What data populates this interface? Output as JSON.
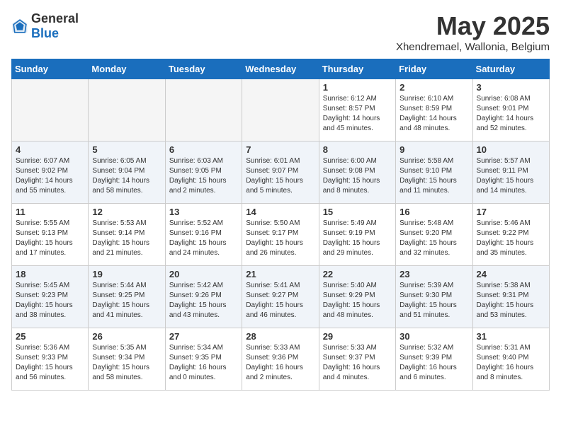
{
  "logo": {
    "text_general": "General",
    "text_blue": "Blue"
  },
  "header": {
    "title": "May 2025",
    "subtitle": "Xhendremael, Wallonia, Belgium"
  },
  "days_of_week": [
    "Sunday",
    "Monday",
    "Tuesday",
    "Wednesday",
    "Thursday",
    "Friday",
    "Saturday"
  ],
  "weeks": [
    [
      {
        "day": "",
        "info": ""
      },
      {
        "day": "",
        "info": ""
      },
      {
        "day": "",
        "info": ""
      },
      {
        "day": "",
        "info": ""
      },
      {
        "day": "1",
        "info": "Sunrise: 6:12 AM\nSunset: 8:57 PM\nDaylight: 14 hours\nand 45 minutes."
      },
      {
        "day": "2",
        "info": "Sunrise: 6:10 AM\nSunset: 8:59 PM\nDaylight: 14 hours\nand 48 minutes."
      },
      {
        "day": "3",
        "info": "Sunrise: 6:08 AM\nSunset: 9:01 PM\nDaylight: 14 hours\nand 52 minutes."
      }
    ],
    [
      {
        "day": "4",
        "info": "Sunrise: 6:07 AM\nSunset: 9:02 PM\nDaylight: 14 hours\nand 55 minutes."
      },
      {
        "day": "5",
        "info": "Sunrise: 6:05 AM\nSunset: 9:04 PM\nDaylight: 14 hours\nand 58 minutes."
      },
      {
        "day": "6",
        "info": "Sunrise: 6:03 AM\nSunset: 9:05 PM\nDaylight: 15 hours\nand 2 minutes."
      },
      {
        "day": "7",
        "info": "Sunrise: 6:01 AM\nSunset: 9:07 PM\nDaylight: 15 hours\nand 5 minutes."
      },
      {
        "day": "8",
        "info": "Sunrise: 6:00 AM\nSunset: 9:08 PM\nDaylight: 15 hours\nand 8 minutes."
      },
      {
        "day": "9",
        "info": "Sunrise: 5:58 AM\nSunset: 9:10 PM\nDaylight: 15 hours\nand 11 minutes."
      },
      {
        "day": "10",
        "info": "Sunrise: 5:57 AM\nSunset: 9:11 PM\nDaylight: 15 hours\nand 14 minutes."
      }
    ],
    [
      {
        "day": "11",
        "info": "Sunrise: 5:55 AM\nSunset: 9:13 PM\nDaylight: 15 hours\nand 17 minutes."
      },
      {
        "day": "12",
        "info": "Sunrise: 5:53 AM\nSunset: 9:14 PM\nDaylight: 15 hours\nand 21 minutes."
      },
      {
        "day": "13",
        "info": "Sunrise: 5:52 AM\nSunset: 9:16 PM\nDaylight: 15 hours\nand 24 minutes."
      },
      {
        "day": "14",
        "info": "Sunrise: 5:50 AM\nSunset: 9:17 PM\nDaylight: 15 hours\nand 26 minutes."
      },
      {
        "day": "15",
        "info": "Sunrise: 5:49 AM\nSunset: 9:19 PM\nDaylight: 15 hours\nand 29 minutes."
      },
      {
        "day": "16",
        "info": "Sunrise: 5:48 AM\nSunset: 9:20 PM\nDaylight: 15 hours\nand 32 minutes."
      },
      {
        "day": "17",
        "info": "Sunrise: 5:46 AM\nSunset: 9:22 PM\nDaylight: 15 hours\nand 35 minutes."
      }
    ],
    [
      {
        "day": "18",
        "info": "Sunrise: 5:45 AM\nSunset: 9:23 PM\nDaylight: 15 hours\nand 38 minutes."
      },
      {
        "day": "19",
        "info": "Sunrise: 5:44 AM\nSunset: 9:25 PM\nDaylight: 15 hours\nand 41 minutes."
      },
      {
        "day": "20",
        "info": "Sunrise: 5:42 AM\nSunset: 9:26 PM\nDaylight: 15 hours\nand 43 minutes."
      },
      {
        "day": "21",
        "info": "Sunrise: 5:41 AM\nSunset: 9:27 PM\nDaylight: 15 hours\nand 46 minutes."
      },
      {
        "day": "22",
        "info": "Sunrise: 5:40 AM\nSunset: 9:29 PM\nDaylight: 15 hours\nand 48 minutes."
      },
      {
        "day": "23",
        "info": "Sunrise: 5:39 AM\nSunset: 9:30 PM\nDaylight: 15 hours\nand 51 minutes."
      },
      {
        "day": "24",
        "info": "Sunrise: 5:38 AM\nSunset: 9:31 PM\nDaylight: 15 hours\nand 53 minutes."
      }
    ],
    [
      {
        "day": "25",
        "info": "Sunrise: 5:36 AM\nSunset: 9:33 PM\nDaylight: 15 hours\nand 56 minutes."
      },
      {
        "day": "26",
        "info": "Sunrise: 5:35 AM\nSunset: 9:34 PM\nDaylight: 15 hours\nand 58 minutes."
      },
      {
        "day": "27",
        "info": "Sunrise: 5:34 AM\nSunset: 9:35 PM\nDaylight: 16 hours\nand 0 minutes."
      },
      {
        "day": "28",
        "info": "Sunrise: 5:33 AM\nSunset: 9:36 PM\nDaylight: 16 hours\nand 2 minutes."
      },
      {
        "day": "29",
        "info": "Sunrise: 5:33 AM\nSunset: 9:37 PM\nDaylight: 16 hours\nand 4 minutes."
      },
      {
        "day": "30",
        "info": "Sunrise: 5:32 AM\nSunset: 9:39 PM\nDaylight: 16 hours\nand 6 minutes."
      },
      {
        "day": "31",
        "info": "Sunrise: 5:31 AM\nSunset: 9:40 PM\nDaylight: 16 hours\nand 8 minutes."
      }
    ]
  ]
}
